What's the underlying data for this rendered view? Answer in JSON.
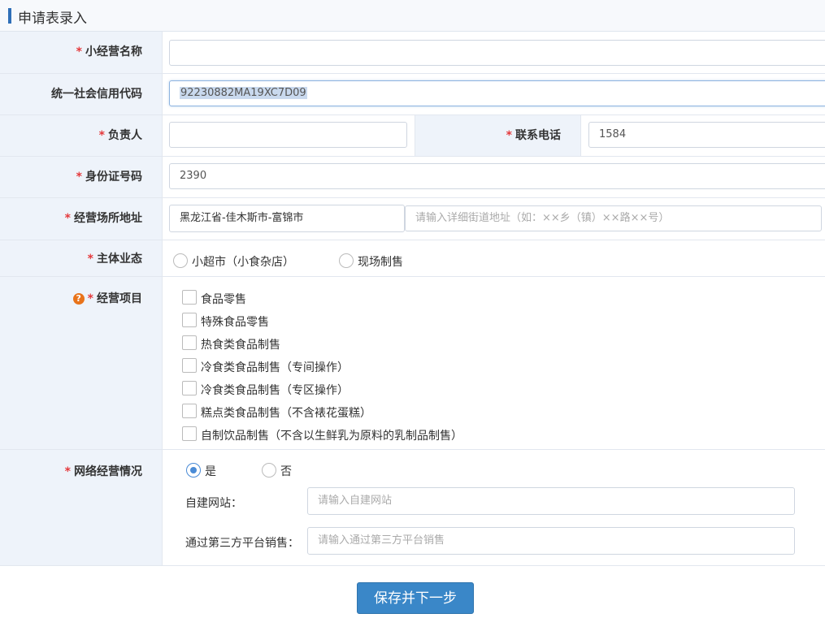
{
  "header": {
    "title": "申请表录入"
  },
  "fields": {
    "business_name": {
      "label": "小经营名称",
      "value": ""
    },
    "credit_code": {
      "label": "统一社会信用代码",
      "value": "92230882MA19XC7D09"
    },
    "person": {
      "label": "负责人",
      "value": ""
    },
    "phone": {
      "label": "联系电话",
      "value": "1584"
    },
    "id_number": {
      "label": "身份证号码",
      "value": "2390"
    },
    "address": {
      "label": "经营场所地址",
      "region": "黑龙江省-佳木斯市-富锦市",
      "detail_placeholder": "请输入详细街道地址（如：××乡（镇）××路××号）"
    },
    "business_form": {
      "label": "主体业态",
      "options": [
        "小超市（小食杂店）",
        "现场制售"
      ]
    },
    "business_items": {
      "label": "经营项目",
      "options": [
        "食品零售",
        "特殊食品零售",
        "热食类食品制售",
        "冷食类食品制售（专间操作）",
        "冷食类食品制售（专区操作）",
        "糕点类食品制售（不含裱花蛋糕）",
        "自制饮品制售（不含以生鲜乳为原料的乳制品制售）"
      ]
    },
    "online": {
      "label": "网络经营情况",
      "yes": "是",
      "no": "否",
      "website_label": "自建网站：",
      "website_placeholder": "请输入自建网站",
      "platform_label": "通过第三方平台销售：",
      "platform_placeholder": "请输入通过第三方平台销售"
    }
  },
  "required_mark": "*",
  "help_icon": "?",
  "buttons": {
    "save_next": "保存并下一步"
  },
  "colors": {
    "accent": "#3a87c8",
    "required": "#e4393c",
    "help": "#e8731a"
  }
}
